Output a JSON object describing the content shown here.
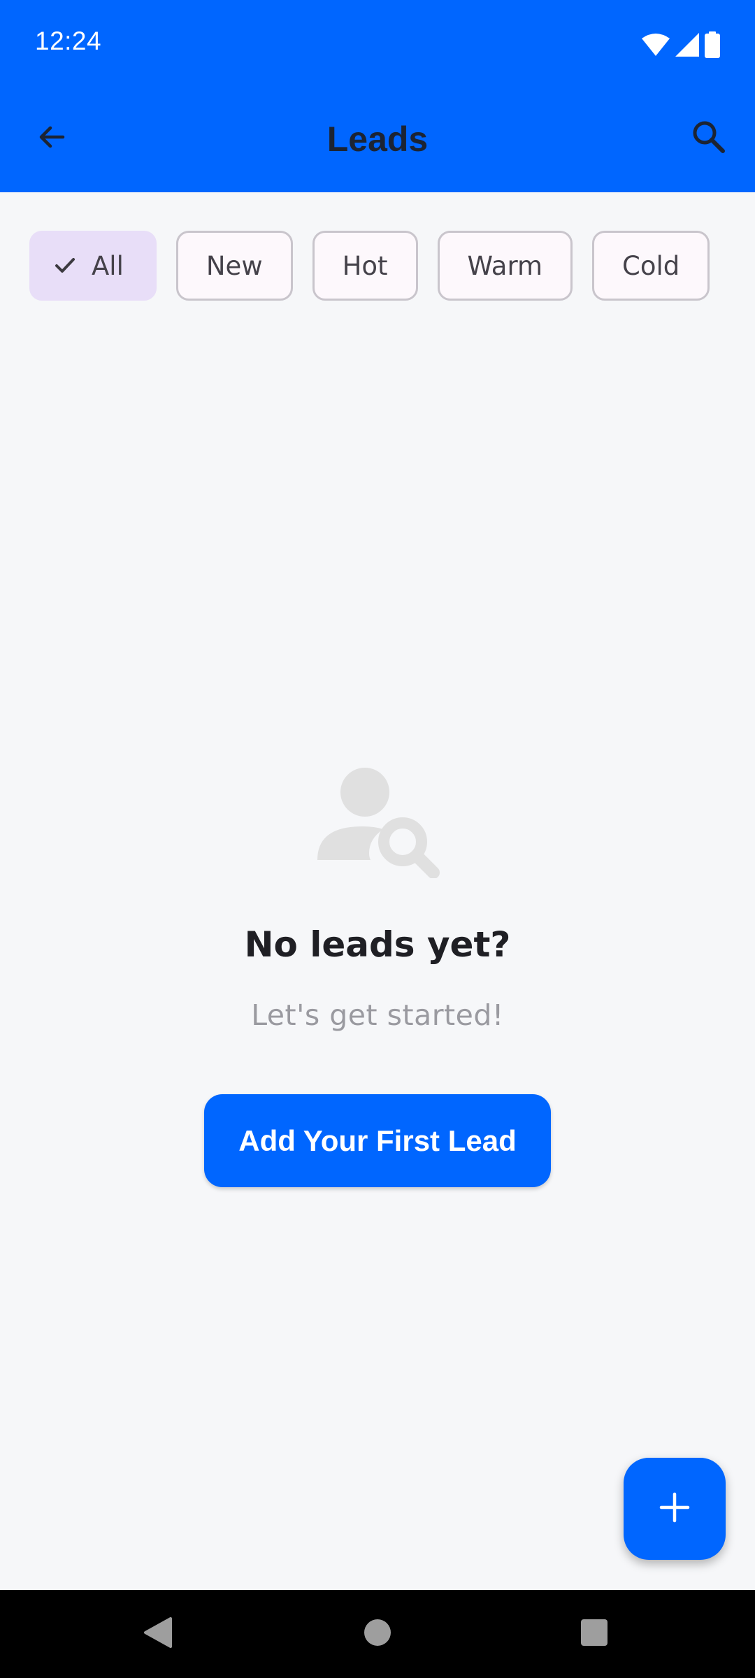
{
  "status_bar": {
    "time": "12:24",
    "icons": [
      "wifi-icon",
      "cellular-signal-icon",
      "battery-icon"
    ]
  },
  "app_bar": {
    "title": "Leads",
    "back_icon": "arrow-back-icon",
    "search_icon": "search-icon"
  },
  "filters": {
    "chips": [
      {
        "label": "All",
        "selected": true
      },
      {
        "label": "New",
        "selected": false
      },
      {
        "label": "Hot",
        "selected": false
      },
      {
        "label": "Warm",
        "selected": false
      },
      {
        "label": "Cold",
        "selected": false
      }
    ]
  },
  "empty_state": {
    "icon": "person-search-icon",
    "title": "No leads yet?",
    "subtitle": "Let's get started!",
    "button_label": "Add Your First Lead"
  },
  "fab": {
    "icon": "plus-icon"
  },
  "nav_bar": {
    "buttons": [
      "nav-back-icon",
      "nav-home-icon",
      "nav-recents-icon"
    ]
  },
  "colors": {
    "primary": "#0066ff",
    "background": "#f6f7f9",
    "chip_selected": "#e8def8",
    "title_text": "#1c2433",
    "subtitle_text": "#9a9aa0"
  }
}
